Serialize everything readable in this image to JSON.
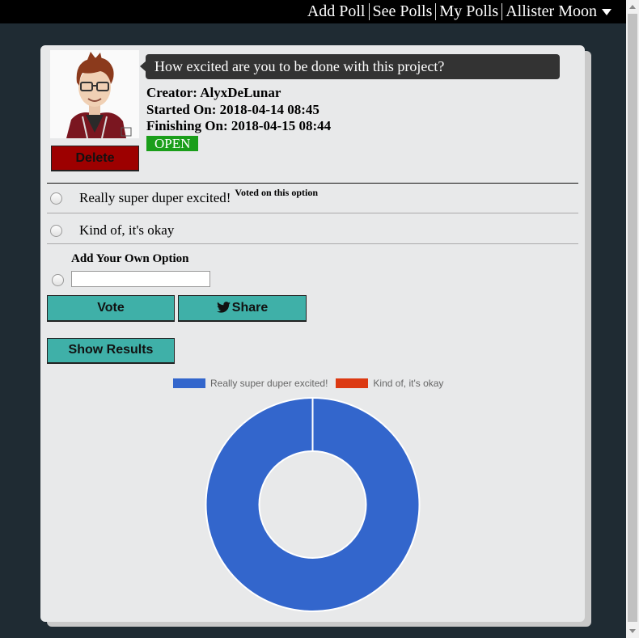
{
  "nav": {
    "add_poll": "Add Poll",
    "see_polls": "See Polls",
    "my_polls": "My Polls",
    "user_name": "Allister Moon"
  },
  "poll": {
    "question": "How excited are you to be done with this project?",
    "creator_label": "Creator:",
    "creator": "AlyxDeLunar",
    "started_label": "Started On:",
    "started": "2018-04-14 08:45",
    "finishing_label": "Finishing On:",
    "finishing": "2018-04-15 08:44",
    "status": "OPEN",
    "delete_label": "Delete",
    "options": [
      {
        "label": "Really super duper excited!",
        "note": "Voted on this option"
      },
      {
        "label": "Kind of, it's okay",
        "note": ""
      }
    ],
    "add_own_label": "Add Your Own Option",
    "own_option_value": "",
    "vote_label": "Vote",
    "share_label": "Share",
    "show_results_label": "Show Results"
  },
  "colors": {
    "status_open": "#1a9e1a",
    "delete": "#9d0000",
    "accent_teal": "#3fb0a8",
    "series_1": "#3366cc",
    "series_2": "#dc3912"
  },
  "chart_data": {
    "type": "pie",
    "donut": true,
    "labels": [
      "Really super duper excited!",
      "Kind of, it's okay"
    ],
    "values": [
      1,
      0
    ],
    "colors": [
      "#3366cc",
      "#dc3912"
    ],
    "legend": "top"
  }
}
